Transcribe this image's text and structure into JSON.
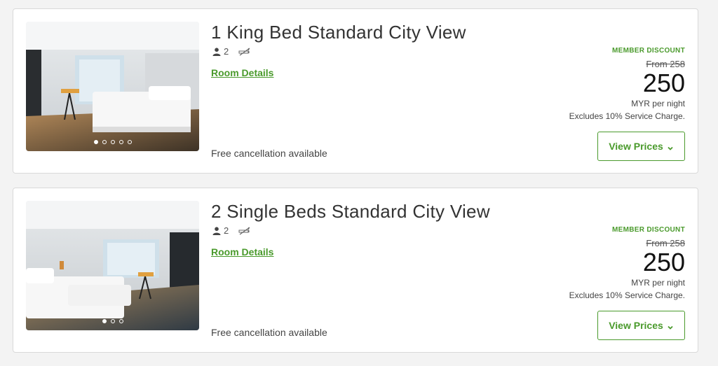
{
  "rooms": [
    {
      "title": "1 King Bed Standard City View",
      "guests": "2",
      "details_label": "Room Details",
      "cancellation": "Free cancellation available",
      "discount_label": "MEMBER DISCOUNT",
      "original_price": "From 258",
      "price": "250",
      "price_unit": "MYR per night",
      "excludes": "Excludes 10% Service Charge.",
      "button_label": "View Prices",
      "photo_count": 5,
      "photo_active": 1,
      "icons": [
        "person-icon",
        "no-smoking-icon",
        "chevron-down-icon"
      ]
    },
    {
      "title": "2 Single Beds Standard City View",
      "guests": "2",
      "details_label": "Room Details",
      "cancellation": "Free cancellation available",
      "discount_label": "MEMBER DISCOUNT",
      "original_price": "From 258",
      "price": "250",
      "price_unit": "MYR per night",
      "excludes": "Excludes 10% Service Charge.",
      "button_label": "View Prices",
      "photo_count": 3,
      "photo_active": 1,
      "icons": [
        "person-icon",
        "no-smoking-icon",
        "chevron-down-icon"
      ]
    }
  ],
  "colors": {
    "accent_green": "#4a9a2c",
    "card_border": "#d9d9d9",
    "background": "#f3f3f3"
  }
}
